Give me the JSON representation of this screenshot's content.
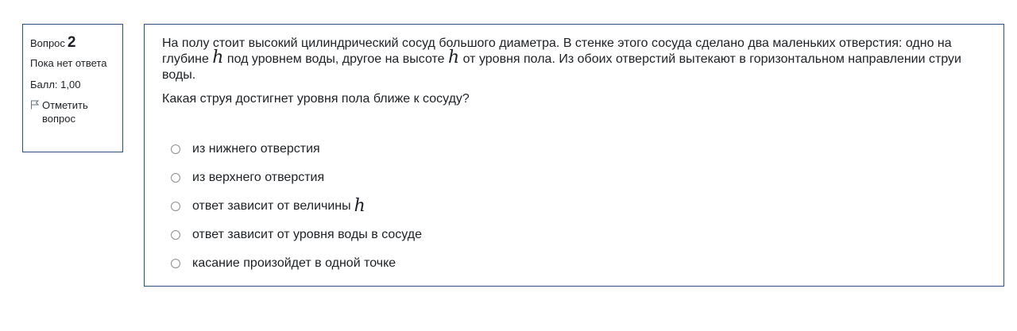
{
  "question_info": {
    "question_word": "Вопрос",
    "question_number": "2",
    "state": "Пока нет ответа",
    "grade": "Балл: 1,00",
    "flag_label": "Отметить вопрос",
    "flag_icon": "flag-outline-icon"
  },
  "question": {
    "text_part1": "На полу стоит высокий цилиндрический сосуд большого диаметра. В стенке этого сосуда сделано два маленьких отверстия: одно на глубине",
    "var1": "h",
    "text_part2": "под уровнем воды, другое на высоте",
    "var2": "h",
    "text_part3": "от уровня пола. Из обоих отверстий вытекают в горизонтальном направлении струи воды.",
    "prompt": "Какая струя достигнет уровня пола ближе к сосуду?"
  },
  "answers": [
    {
      "label": "из нижнего отверстия",
      "var": ""
    },
    {
      "label": "из верхнего отверстия",
      "var": ""
    },
    {
      "label": "ответ зависит от величины",
      "var": "h"
    },
    {
      "label": "ответ зависит от уровня воды в сосуде",
      "var": ""
    },
    {
      "label": "касание произойдет в одной точке",
      "var": ""
    }
  ],
  "colors": {
    "border": "#2d4f7c",
    "text": "#1d2125",
    "radio_border": "#8a8f95"
  }
}
